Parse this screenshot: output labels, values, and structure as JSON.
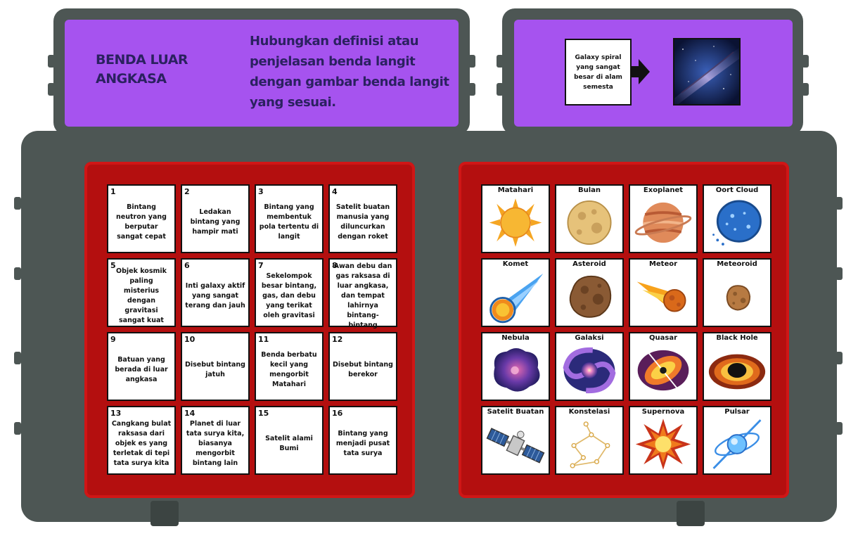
{
  "header": {
    "title": "BENDA LUAR ANGKASA",
    "instruction": "Hubungkan definisi atau penjelasan benda langit dengan gambar benda langit yang sesuai.",
    "example_text": "Galaxy spiral yang sangat besar di alam semesta"
  },
  "definitions": [
    {
      "num": "1",
      "text": "Bintang neutron yang berputar sangat cepat"
    },
    {
      "num": "2",
      "text": "Ledakan bintang yang hampir mati"
    },
    {
      "num": "3",
      "text": "Bintang yang membentuk pola tertentu di langit"
    },
    {
      "num": "4",
      "text": "Satelit buatan manusia yang diluncurkan dengan roket"
    },
    {
      "num": "5",
      "text": "Objek kosmik paling misterius dengan gravitasi sangat kuat"
    },
    {
      "num": "6",
      "text": "Inti galaxy aktif yang sangat terang dan jauh"
    },
    {
      "num": "7",
      "text": "Sekelompok besar bintang, gas, dan debu yang terikat oleh gravitasi"
    },
    {
      "num": "8",
      "text": "Awan debu dan gas raksasa di luar angkasa, dan tempat lahirnya bintang-bintang"
    },
    {
      "num": "9",
      "text": "Batuan yang berada di luar angkasa"
    },
    {
      "num": "10",
      "text": "Disebut bintang jatuh"
    },
    {
      "num": "11",
      "text": "Benda berbatu kecil yang mengorbit Matahari"
    },
    {
      "num": "12",
      "text": "Disebut bintang berekor"
    },
    {
      "num": "13",
      "text": "Cangkang bulat raksasa dari objek es yang terletak di tepi tata surya kita"
    },
    {
      "num": "14",
      "text": "Planet di luar tata surya kita, biasanya mengorbit bintang lain"
    },
    {
      "num": "15",
      "text": "Satelit alami Bumi"
    },
    {
      "num": "16",
      "text": "Bintang yang menjadi pusat tata surya"
    }
  ],
  "pictures": [
    {
      "label": "Matahari",
      "icon": "sun-icon"
    },
    {
      "label": "Bulan",
      "icon": "moon-icon"
    },
    {
      "label": "Exoplanet",
      "icon": "exoplanet-icon"
    },
    {
      "label": "Oort Cloud",
      "icon": "oort-cloud-icon"
    },
    {
      "label": "Komet",
      "icon": "comet-icon"
    },
    {
      "label": "Asteroid",
      "icon": "asteroid-icon"
    },
    {
      "label": "Meteor",
      "icon": "meteor-icon"
    },
    {
      "label": "Meteoroid",
      "icon": "meteoroid-icon"
    },
    {
      "label": "Nebula",
      "icon": "nebula-icon"
    },
    {
      "label": "Galaksi",
      "icon": "galaxy-icon"
    },
    {
      "label": "Quasar",
      "icon": "quasar-icon"
    },
    {
      "label": "Black Hole",
      "icon": "black-hole-icon"
    },
    {
      "label": "Satelit Buatan",
      "icon": "satellite-icon"
    },
    {
      "label": "Konstelasi",
      "icon": "constellation-icon"
    },
    {
      "label": "Supernova",
      "icon": "supernova-icon"
    },
    {
      "label": "Pulsar",
      "icon": "pulsar-icon"
    }
  ],
  "colors": {
    "frame": "#4d5654",
    "header_panel": "#a653ef",
    "board": "#b40f0f",
    "title_text": "#2b2160"
  }
}
